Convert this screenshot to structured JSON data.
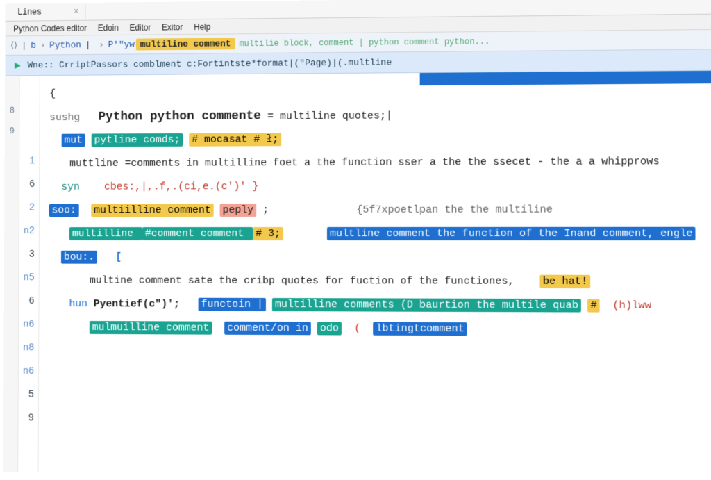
{
  "titlebar": {
    "tab": "Lines",
    "close_glyph": "×"
  },
  "menubar": [
    "Python Codes editor",
    "Edoin",
    "Editor",
    "Exitor",
    "Help"
  ],
  "toolbar": {
    "nav_glyph": "⟨⟩",
    "crumb1": "ɓ",
    "crumb2": "Python",
    "crumb3": "P'\"yw",
    "badge": "multiline comment",
    "tail": "multilie block, comment | python comment python..."
  },
  "infobar": {
    "play_glyph": "▶",
    "text": "Wne:: CrriptPassors comblment c:Fortintste*format|(\"Page)|(.multline"
  },
  "gutterA": [
    "",
    "8",
    "9",
    "",
    "",
    "",
    "",
    "",
    "",
    "",
    ""
  ],
  "gutterB": [
    "",
    "",
    "",
    "1",
    "6",
    "2",
    "n2",
    "3",
    "n5",
    "6",
    "n6",
    "n8",
    "n6",
    "5",
    "9"
  ],
  "code": {
    "l1": {
      "a": "{"
    },
    "l2": {
      "a": "sushg",
      "b": "Python python commente",
      "c": " = multiline quotes;|"
    },
    "l3": {
      "a": "mut",
      "b": "pytline comds;",
      "c": "# mocasat # ł;"
    },
    "l4": {
      "a": "muttline =comments in multilline foet a the function sser a the the ssecet - the a a whipprows"
    },
    "l5": {
      "a": "syn",
      "b": "cbes:,|,.f,.(ci,e.(c')' }"
    },
    "l6": {
      "a": "soo:",
      "b": "multiilline comment",
      "c": "peply",
      "d": ";",
      "e": "{5f7xpoetlpan the the multiline"
    },
    "l7": {
      "a": "multilline ",
      "b": "#comment comment ",
      "c": "# 3;",
      "d": "multline comment the function of the Inand comment, engle"
    },
    "l8": {
      "a": "bou:.",
      "b": "["
    },
    "l9": {
      "a": "multine comment sate the cribp quotes for fuction of the functiones,",
      "b": "be hat!"
    },
    "l10": {
      "a": "hun",
      "b": "Pyentief(c\")';",
      "c": "functoin |",
      "d": "multilline comments (D baurtion the multile quab",
      "e": "#",
      "f": "(h)lww"
    },
    "l11": {
      "a": "mulmuilline comment",
      "b": "comment/on in",
      "c": "odo",
      "d": "(",
      "e": "lbtingtcomment"
    }
  }
}
